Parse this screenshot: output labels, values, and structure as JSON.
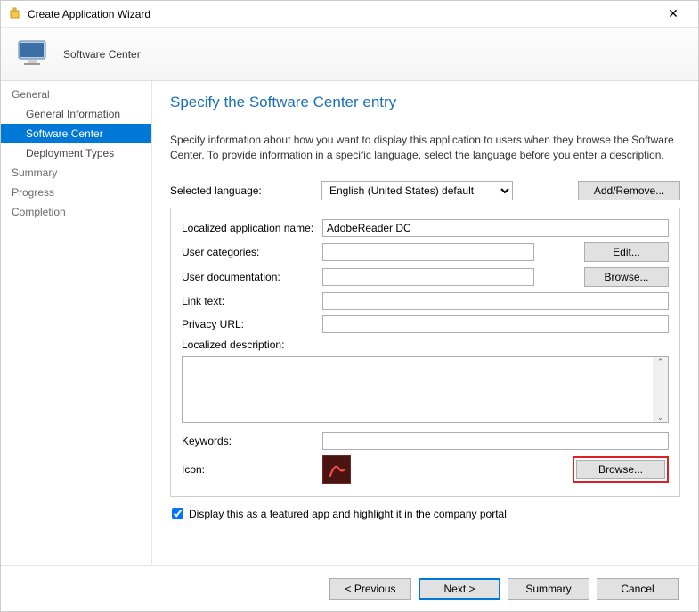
{
  "titlebar": {
    "title": "Create Application Wizard"
  },
  "header": {
    "label": "Software Center"
  },
  "sidebar": {
    "items": [
      {
        "label": "General",
        "type": "cat"
      },
      {
        "label": "General Information",
        "type": "item"
      },
      {
        "label": "Software Center",
        "type": "item",
        "selected": true
      },
      {
        "label": "Deployment Types",
        "type": "item"
      },
      {
        "label": "Summary",
        "type": "cat"
      },
      {
        "label": "Progress",
        "type": "cat"
      },
      {
        "label": "Completion",
        "type": "cat"
      }
    ]
  },
  "page": {
    "title": "Specify the Software Center entry",
    "instructions": "Specify information about how you want to display this application to users when they browse the Software Center. To provide information in a specific language, select the language before you enter a description.",
    "selected_language_label": "Selected language:",
    "selected_language_value": "English (United States) default",
    "add_remove_label": "Add/Remove...",
    "form": {
      "app_name_label": "Localized application name:",
      "app_name_value": "AdobeReader DC",
      "user_categories_label": "User categories:",
      "user_categories_value": "",
      "edit_label": "Edit...",
      "user_doc_label": "User documentation:",
      "user_doc_value": "",
      "browse_label": "Browse...",
      "link_text_label": "Link text:",
      "link_text_value": "",
      "privacy_label": "Privacy URL:",
      "privacy_value": "",
      "description_label": "Localized description:",
      "description_value": "",
      "keywords_label": "Keywords:",
      "keywords_value": "",
      "icon_label": "Icon:",
      "icon_browse_label": "Browse..."
    },
    "featured_label": "Display this as a featured app and highlight it in the company portal",
    "featured_checked": true
  },
  "footer": {
    "previous": "< Previous",
    "next": "Next >",
    "summary": "Summary",
    "cancel": "Cancel"
  }
}
